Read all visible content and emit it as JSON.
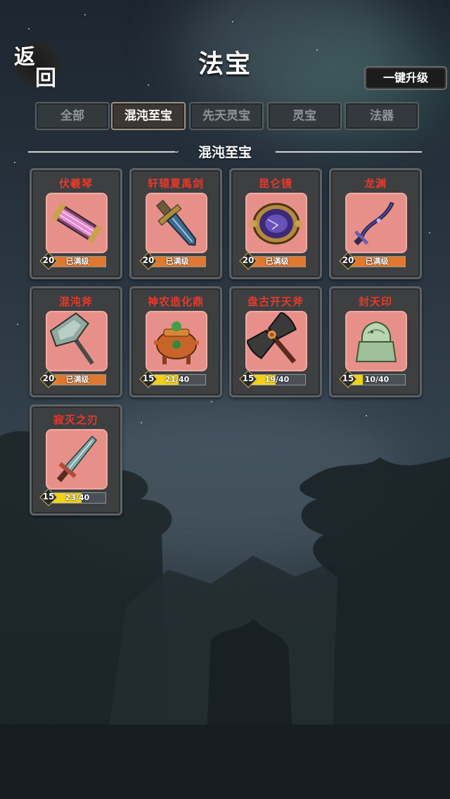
{
  "header": {
    "back_label_1": "返",
    "back_label_2": "回",
    "title": "法宝",
    "upgrade_all_label": "一键升级"
  },
  "tabs": [
    {
      "label": "全部",
      "active": false
    },
    {
      "label": "混沌至宝",
      "active": true
    },
    {
      "label": "先天灵宝",
      "active": false
    },
    {
      "label": "灵宝",
      "active": false
    },
    {
      "label": "法器",
      "active": false
    }
  ],
  "section": {
    "title": "混沌至宝"
  },
  "items": [
    {
      "name": "伏羲琴",
      "icon": "fuxi-qin-icon",
      "level": "20",
      "status": "已满级",
      "progress": 1.0,
      "bar_color": "orange"
    },
    {
      "name": "轩辕夏禹剑",
      "icon": "xuanyuan-sword-icon",
      "level": "20",
      "status": "已满级",
      "progress": 1.0,
      "bar_color": "orange"
    },
    {
      "name": "昆仑镜",
      "icon": "kunlun-mirror-icon",
      "level": "20",
      "status": "已满级",
      "progress": 1.0,
      "bar_color": "orange"
    },
    {
      "name": "龙渊",
      "icon": "longyuan-blade-icon",
      "level": "20",
      "status": "已满级",
      "progress": 1.0,
      "bar_color": "orange"
    },
    {
      "name": "混沌斧",
      "icon": "chaos-axe-icon",
      "level": "20",
      "status": "已满级",
      "progress": 1.0,
      "bar_color": "orange"
    },
    {
      "name": "神农造化鼎",
      "icon": "shennong-cauldron-icon",
      "level": "15",
      "status": "21/40",
      "progress": 0.525,
      "bar_color": "yellow"
    },
    {
      "name": "盘古开天斧",
      "icon": "pangu-axe-icon",
      "level": "15",
      "status": "19/40",
      "progress": 0.475,
      "bar_color": "yellow"
    },
    {
      "name": "封天印",
      "icon": "fengtian-seal-icon",
      "level": "15",
      "status": "10/40",
      "progress": 0.25,
      "bar_color": "yellow"
    },
    {
      "name": "寂灭之刃",
      "icon": "jimie-blade-icon",
      "level": "15",
      "status": "23/40",
      "progress": 0.575,
      "bar_color": "yellow"
    }
  ],
  "colors": {
    "item_name": "#e83a2a",
    "art_background": "#e7908a",
    "bar_full": "#e0792f",
    "bar_partial": "#f1d21a"
  }
}
